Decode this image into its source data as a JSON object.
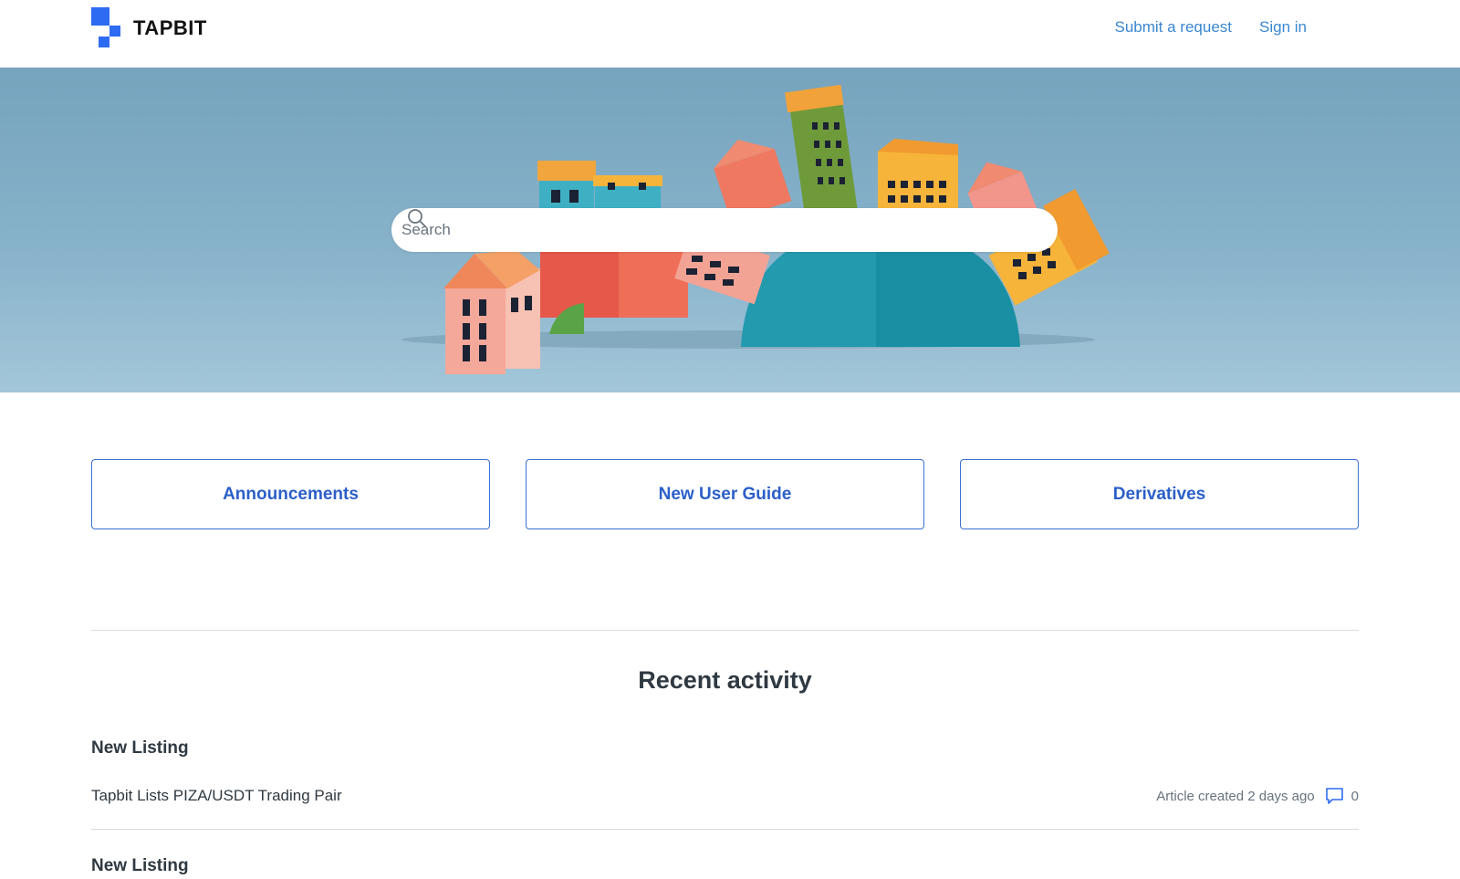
{
  "brand": {
    "name": "TAPBIT",
    "accent": "#2d6cf2"
  },
  "nav": {
    "submit_request": "Submit a request",
    "sign_in": "Sign in"
  },
  "search": {
    "placeholder": "Search",
    "icon": "search-icon"
  },
  "categories": [
    {
      "label": "Announcements"
    },
    {
      "label": "New User Guide"
    },
    {
      "label": "Derivatives"
    }
  ],
  "recent_activity": {
    "title": "Recent activity",
    "items": [
      {
        "category": "New Listing",
        "title": "Tapbit Lists PIZA/USDT Trading Pair",
        "meta": "Article created 2 days ago",
        "comments": "0"
      },
      {
        "category": "New Listing"
      }
    ]
  },
  "colors": {
    "link": "#3b87cf",
    "category_border": "#3b6fd4",
    "category_text": "#2b5fc8"
  }
}
